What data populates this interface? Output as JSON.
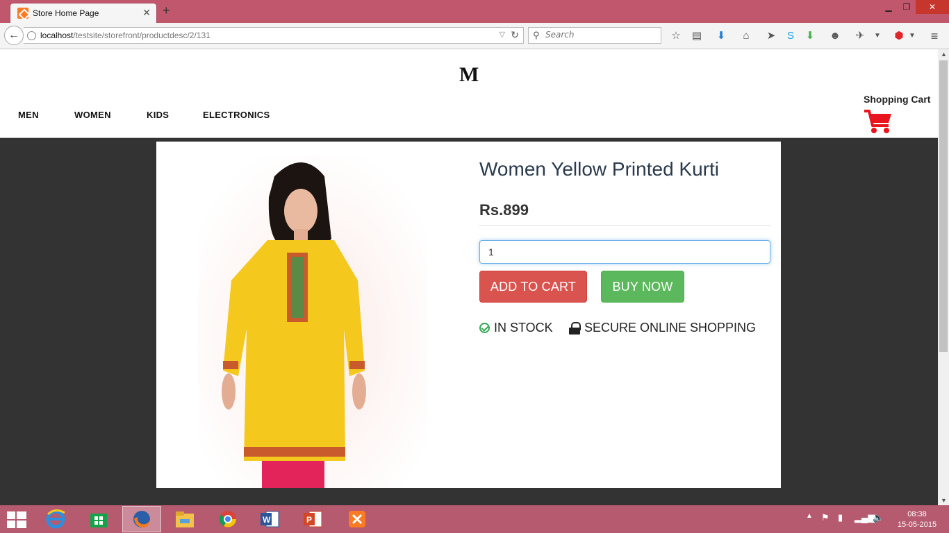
{
  "browser": {
    "tab_title": "Store Home Page",
    "url_host": "localhost",
    "url_path": "/testsite/storefront/productdesc/2/131",
    "search_placeholder": "Search"
  },
  "store": {
    "logo": "M",
    "nav": [
      "MEN",
      "WOMEN",
      "KIDS",
      "ELECTRONICS"
    ],
    "cart_label": "Shopping Cart",
    "cart_color": "#e8141e"
  },
  "product": {
    "title": "Women Yellow Printed Kurti",
    "price": "Rs.899",
    "quantity": "1",
    "add_to_cart": "ADD TO CART",
    "buy_now": "BUY NOW",
    "in_stock": "IN STOCK",
    "secure": "SECURE ONLINE SHOPPING",
    "garment_color": "#f4c81c",
    "leggings_color": "#e3245a"
  },
  "taskbar": {
    "time": "08:38",
    "date": "15-05-2015"
  }
}
